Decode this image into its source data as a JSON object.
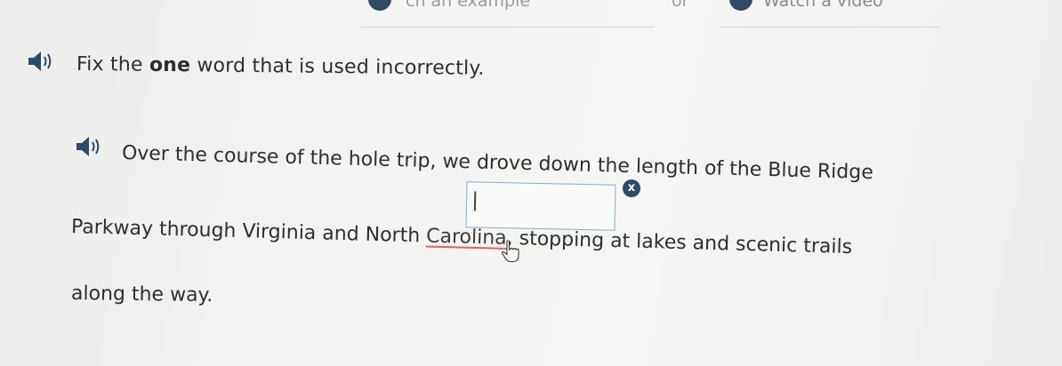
{
  "header": {
    "example_label": "ch an example",
    "or_label": "or",
    "video_label": "Watch a video"
  },
  "instruction": {
    "prefix": "Fix the ",
    "emphasis": "one",
    "suffix": " word that is used incorrectly."
  },
  "sentence": {
    "line1": "Over the course of the hole trip, we drove down the length of the Blue Ridge",
    "line2_before": "Parkway through Virginia and North ",
    "line2_marked": "Carolina",
    "line2_after": ", stopping at lakes and scenic trails",
    "line3": "along the way."
  },
  "answer": {
    "value": "",
    "clear_symbol": "x"
  },
  "icons": {
    "speaker": "speaker-icon",
    "clear": "close-icon",
    "cursor": "hand-cursor-icon"
  },
  "colors": {
    "accent": "#2d4a68",
    "input_border": "#7fb2cf",
    "spell_underline": "#e06060"
  }
}
